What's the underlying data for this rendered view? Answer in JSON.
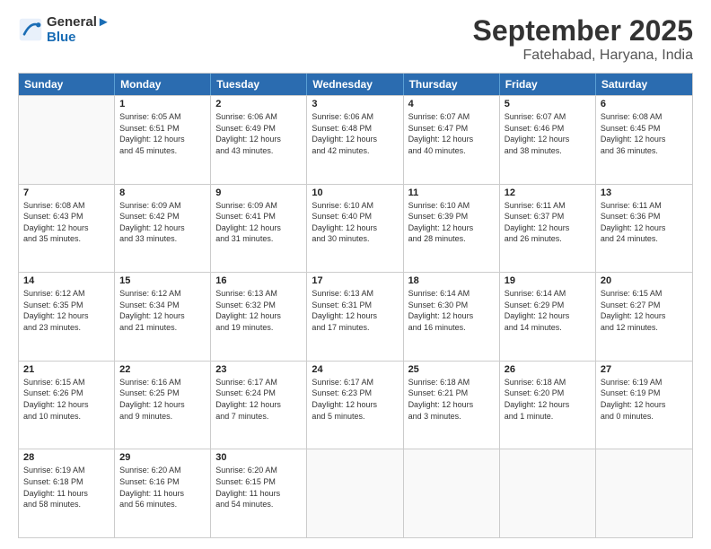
{
  "logo": {
    "line1": "General",
    "line2": "Blue"
  },
  "title": "September 2025",
  "location": "Fatehabad, Haryana, India",
  "weekdays": [
    "Sunday",
    "Monday",
    "Tuesday",
    "Wednesday",
    "Thursday",
    "Friday",
    "Saturday"
  ],
  "rows": [
    [
      {
        "day": "",
        "info": ""
      },
      {
        "day": "1",
        "info": "Sunrise: 6:05 AM\nSunset: 6:51 PM\nDaylight: 12 hours\nand 45 minutes."
      },
      {
        "day": "2",
        "info": "Sunrise: 6:06 AM\nSunset: 6:49 PM\nDaylight: 12 hours\nand 43 minutes."
      },
      {
        "day": "3",
        "info": "Sunrise: 6:06 AM\nSunset: 6:48 PM\nDaylight: 12 hours\nand 42 minutes."
      },
      {
        "day": "4",
        "info": "Sunrise: 6:07 AM\nSunset: 6:47 PM\nDaylight: 12 hours\nand 40 minutes."
      },
      {
        "day": "5",
        "info": "Sunrise: 6:07 AM\nSunset: 6:46 PM\nDaylight: 12 hours\nand 38 minutes."
      },
      {
        "day": "6",
        "info": "Sunrise: 6:08 AM\nSunset: 6:45 PM\nDaylight: 12 hours\nand 36 minutes."
      }
    ],
    [
      {
        "day": "7",
        "info": "Sunrise: 6:08 AM\nSunset: 6:43 PM\nDaylight: 12 hours\nand 35 minutes."
      },
      {
        "day": "8",
        "info": "Sunrise: 6:09 AM\nSunset: 6:42 PM\nDaylight: 12 hours\nand 33 minutes."
      },
      {
        "day": "9",
        "info": "Sunrise: 6:09 AM\nSunset: 6:41 PM\nDaylight: 12 hours\nand 31 minutes."
      },
      {
        "day": "10",
        "info": "Sunrise: 6:10 AM\nSunset: 6:40 PM\nDaylight: 12 hours\nand 30 minutes."
      },
      {
        "day": "11",
        "info": "Sunrise: 6:10 AM\nSunset: 6:39 PM\nDaylight: 12 hours\nand 28 minutes."
      },
      {
        "day": "12",
        "info": "Sunrise: 6:11 AM\nSunset: 6:37 PM\nDaylight: 12 hours\nand 26 minutes."
      },
      {
        "day": "13",
        "info": "Sunrise: 6:11 AM\nSunset: 6:36 PM\nDaylight: 12 hours\nand 24 minutes."
      }
    ],
    [
      {
        "day": "14",
        "info": "Sunrise: 6:12 AM\nSunset: 6:35 PM\nDaylight: 12 hours\nand 23 minutes."
      },
      {
        "day": "15",
        "info": "Sunrise: 6:12 AM\nSunset: 6:34 PM\nDaylight: 12 hours\nand 21 minutes."
      },
      {
        "day": "16",
        "info": "Sunrise: 6:13 AM\nSunset: 6:32 PM\nDaylight: 12 hours\nand 19 minutes."
      },
      {
        "day": "17",
        "info": "Sunrise: 6:13 AM\nSunset: 6:31 PM\nDaylight: 12 hours\nand 17 minutes."
      },
      {
        "day": "18",
        "info": "Sunrise: 6:14 AM\nSunset: 6:30 PM\nDaylight: 12 hours\nand 16 minutes."
      },
      {
        "day": "19",
        "info": "Sunrise: 6:14 AM\nSunset: 6:29 PM\nDaylight: 12 hours\nand 14 minutes."
      },
      {
        "day": "20",
        "info": "Sunrise: 6:15 AM\nSunset: 6:27 PM\nDaylight: 12 hours\nand 12 minutes."
      }
    ],
    [
      {
        "day": "21",
        "info": "Sunrise: 6:15 AM\nSunset: 6:26 PM\nDaylight: 12 hours\nand 10 minutes."
      },
      {
        "day": "22",
        "info": "Sunrise: 6:16 AM\nSunset: 6:25 PM\nDaylight: 12 hours\nand 9 minutes."
      },
      {
        "day": "23",
        "info": "Sunrise: 6:17 AM\nSunset: 6:24 PM\nDaylight: 12 hours\nand 7 minutes."
      },
      {
        "day": "24",
        "info": "Sunrise: 6:17 AM\nSunset: 6:23 PM\nDaylight: 12 hours\nand 5 minutes."
      },
      {
        "day": "25",
        "info": "Sunrise: 6:18 AM\nSunset: 6:21 PM\nDaylight: 12 hours\nand 3 minutes."
      },
      {
        "day": "26",
        "info": "Sunrise: 6:18 AM\nSunset: 6:20 PM\nDaylight: 12 hours\nand 1 minute."
      },
      {
        "day": "27",
        "info": "Sunrise: 6:19 AM\nSunset: 6:19 PM\nDaylight: 12 hours\nand 0 minutes."
      }
    ],
    [
      {
        "day": "28",
        "info": "Sunrise: 6:19 AM\nSunset: 6:18 PM\nDaylight: 11 hours\nand 58 minutes."
      },
      {
        "day": "29",
        "info": "Sunrise: 6:20 AM\nSunset: 6:16 PM\nDaylight: 11 hours\nand 56 minutes."
      },
      {
        "day": "30",
        "info": "Sunrise: 6:20 AM\nSunset: 6:15 PM\nDaylight: 11 hours\nand 54 minutes."
      },
      {
        "day": "",
        "info": ""
      },
      {
        "day": "",
        "info": ""
      },
      {
        "day": "",
        "info": ""
      },
      {
        "day": "",
        "info": ""
      }
    ]
  ]
}
